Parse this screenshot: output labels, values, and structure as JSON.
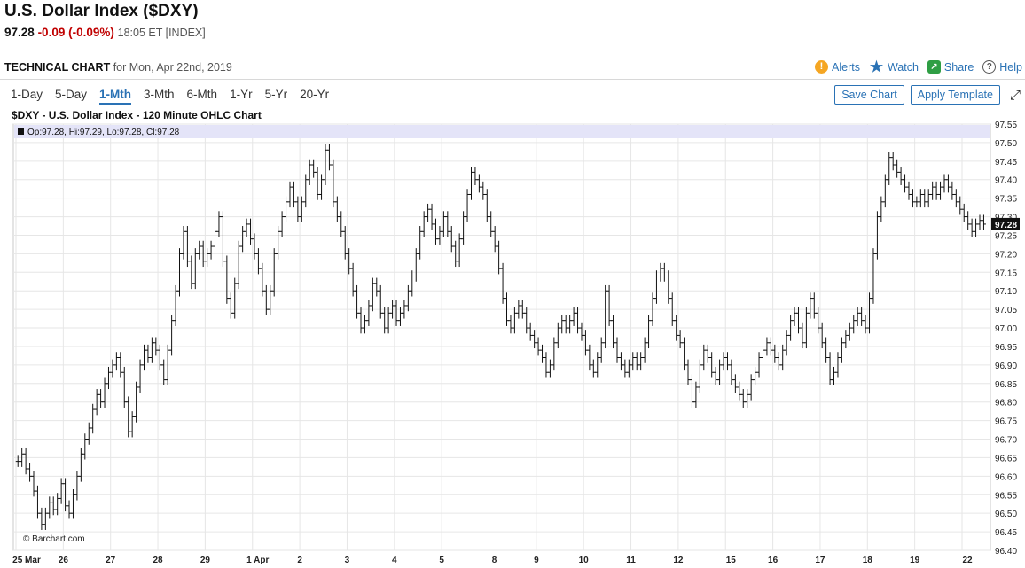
{
  "header": {
    "title": "U.S. Dollar Index ($DXY)",
    "last": "97.28",
    "change": "-0.09 (-0.09%)",
    "time": "18:05 ET [INDEX]"
  },
  "toolbar": {
    "label": "TECHNICAL CHART",
    "date_text": "for Mon, Apr 22nd, 2019",
    "actions": {
      "alerts": "Alerts",
      "watch": "Watch",
      "share": "Share",
      "help": "Help"
    },
    "ranges": [
      "1-Day",
      "5-Day",
      "1-Mth",
      "3-Mth",
      "6-Mth",
      "1-Yr",
      "5-Yr",
      "20-Yr"
    ],
    "active_range": "1-Mth",
    "save_chart": "Save Chart",
    "apply_template": "Apply Template"
  },
  "chart_data": {
    "type": "ohlc",
    "title": "$DXY - U.S. Dollar Index - 120 Minute OHLC Chart",
    "legend": "Op:97.28, Hi:97.29, Lo:97.28, Cl:97.28",
    "watermark": "© Barchart.com",
    "last_price_label": "97.28",
    "ylim": [
      96.4,
      97.55
    ],
    "y_ticks": [
      "97.55",
      "97.50",
      "97.45",
      "97.40",
      "97.35",
      "97.30",
      "97.25",
      "97.20",
      "97.15",
      "97.10",
      "97.05",
      "97.00",
      "96.95",
      "96.90",
      "96.85",
      "96.80",
      "96.75",
      "96.70",
      "96.65",
      "96.60",
      "96.55",
      "96.50",
      "96.45",
      "96.40"
    ],
    "x_labels": [
      "25 Mar",
      "26",
      "27",
      "28",
      "29",
      "1 Apr",
      "2",
      "3",
      "4",
      "5",
      "8",
      "9",
      "10",
      "11",
      "12",
      "15",
      "16",
      "17",
      "18",
      "19",
      "22"
    ],
    "x_start": "2019-03-25",
    "x_end": "2019-04-22",
    "grid": true,
    "closes_by_day": [
      [
        96.64,
        96.66,
        96.62,
        96.6,
        96.56,
        96.5,
        96.47,
        96.5,
        96.53,
        96.51,
        96.54,
        96.58
      ],
      [
        96.52,
        96.5,
        96.55,
        96.6,
        96.66,
        96.7,
        96.73,
        96.78,
        96.82,
        96.8,
        96.85,
        96.88
      ],
      [
        96.9,
        96.92,
        96.88,
        96.8,
        96.72,
        96.76,
        96.84,
        96.9,
        96.94,
        96.92,
        96.96,
        96.94
      ],
      [
        96.9,
        96.86,
        96.94,
        97.02,
        97.1,
        97.2,
        97.26,
        97.18,
        97.12,
        97.2,
        97.22,
        97.18
      ],
      [
        97.2,
        97.22,
        97.26,
        97.3,
        97.18,
        97.08,
        97.04,
        97.12,
        97.22,
        97.26,
        97.28,
        97.24
      ],
      [
        97.2,
        97.16,
        97.1,
        97.05,
        97.1,
        97.2,
        97.26,
        97.3,
        97.34,
        97.38,
        97.34,
        97.3
      ],
      [
        97.34,
        97.4,
        97.44,
        97.42,
        97.36,
        97.4,
        97.48,
        97.44,
        97.34,
        97.3,
        97.26,
        97.2
      ],
      [
        97.16,
        97.1,
        97.04,
        97.0,
        97.02,
        97.06,
        97.12,
        97.1,
        97.04,
        97.0,
        97.04,
        97.06
      ],
      [
        97.02,
        97.04,
        97.06,
        97.1,
        97.14,
        97.2,
        97.26,
        97.3,
        97.32,
        97.28,
        97.24,
        97.26
      ],
      [
        97.3,
        97.26,
        97.22,
        97.18,
        97.24,
        97.3,
        97.36,
        97.42,
        97.4,
        97.38,
        97.36,
        97.3
      ],
      [
        97.26,
        97.22,
        97.16,
        97.08,
        97.02,
        97.0,
        97.04,
        97.06,
        97.04,
        97.0,
        96.98,
        96.96
      ],
      [
        96.94,
        96.92,
        96.88,
        96.9,
        96.96,
        97.0,
        97.02,
        97.0,
        97.02,
        97.04,
        97.0,
        96.98
      ],
      [
        96.94,
        96.9,
        96.88,
        96.92,
        96.96,
        97.1,
        97.02,
        96.96,
        96.92,
        96.9,
        96.88,
        96.9
      ],
      [
        96.92,
        96.9,
        96.92,
        96.96,
        97.02,
        97.08,
        97.14,
        97.16,
        97.14,
        97.08,
        97.02,
        96.98
      ],
      [
        96.96,
        96.9,
        96.86,
        96.8,
        96.84,
        96.9,
        96.94,
        96.92,
        96.88,
        96.86,
        96.9,
        96.92
      ],
      [
        96.9,
        96.86,
        96.84,
        96.82,
        96.8,
        96.82,
        96.86,
        96.88,
        96.92,
        96.94,
        96.96,
        96.94
      ],
      [
        96.92,
        96.9,
        96.94,
        96.98,
        97.02,
        97.04,
        97.0,
        96.96,
        97.04,
        97.08,
        97.04,
        97.0
      ],
      [
        96.96,
        96.92,
        96.86,
        96.88,
        96.92,
        96.96,
        96.98,
        97.0,
        97.02,
        97.04,
        97.02,
        97.0
      ],
      [
        97.08,
        97.2,
        97.3,
        97.34,
        97.4,
        97.46,
        97.44,
        97.42,
        97.4,
        97.38,
        97.36,
        97.34
      ],
      [
        97.34,
        97.36,
        97.34,
        97.36,
        97.38,
        97.36,
        97.38,
        97.4,
        97.38,
        97.36,
        97.34,
        97.32
      ],
      [
        97.3,
        97.28,
        97.26,
        97.28,
        97.29,
        97.28
      ]
    ]
  }
}
